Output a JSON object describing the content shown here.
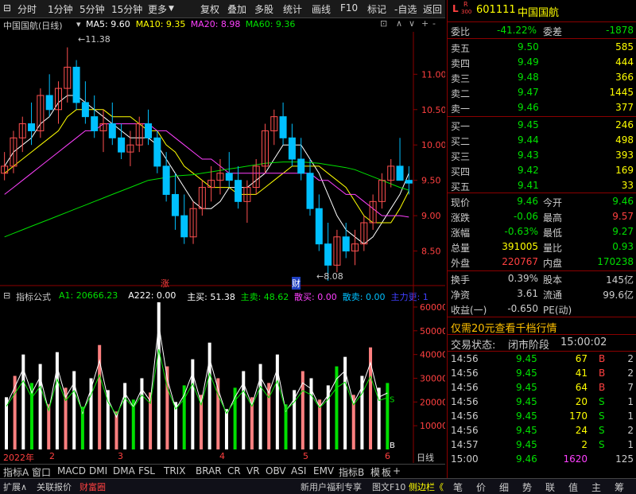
{
  "toolbar": {
    "left": [
      "分时",
      "1分钟",
      "5分钟",
      "15分钟",
      "更多"
    ],
    "right": [
      "复权",
      "叠加",
      "多股",
      "统计",
      "画线",
      "F10",
      "标记",
      "-自选",
      "返回"
    ]
  },
  "chart": {
    "name": "中国国航(日线)",
    "ma": [
      {
        "label": "MA5: 9.60",
        "color": "#ffffff"
      },
      {
        "label": "MA10: 9.35",
        "color": "#ffff00"
      },
      {
        "label": "MA20: 8.98",
        "color": "#ff40ff"
      },
      {
        "label": "MA60: 9.36",
        "color": "#00e000"
      }
    ],
    "high_label": "11.38",
    "low_label": "8.08",
    "marker_zhang": "涨",
    "marker_cai": "财",
    "price_axis": [
      "11.00",
      "10.50",
      "10.00",
      "9.50",
      "9.00",
      "8.50"
    ],
    "colors": {
      "up": "#ff5050",
      "down": "#00c0ff",
      "grid": "#8b0000"
    }
  },
  "chart_data": {
    "type": "line",
    "title": "中国国航(日线)",
    "x": [
      "2022年",
      "2",
      "3",
      "4",
      "5",
      "6"
    ],
    "price_ylim": [
      8.0,
      11.6
    ],
    "candles": [
      [
        9.6,
        9.9,
        9.5,
        9.7
      ],
      [
        9.7,
        10.2,
        9.6,
        10.1
      ],
      [
        10.1,
        10.4,
        9.9,
        10.3
      ],
      [
        10.3,
        10.6,
        10.0,
        10.2
      ],
      [
        10.2,
        10.8,
        10.1,
        10.7
      ],
      [
        10.7,
        11.0,
        10.4,
        10.5
      ],
      [
        10.5,
        10.9,
        10.3,
        10.8
      ],
      [
        10.8,
        11.38,
        10.6,
        11.1
      ],
      [
        11.1,
        11.2,
        10.5,
        10.6
      ],
      [
        10.6,
        10.9,
        10.3,
        10.4
      ],
      [
        10.4,
        10.7,
        10.1,
        10.2
      ],
      [
        10.2,
        10.5,
        9.9,
        10.3
      ],
      [
        10.3,
        10.6,
        10.0,
        10.1
      ],
      [
        10.1,
        10.3,
        9.8,
        9.9
      ],
      [
        9.9,
        10.2,
        9.7,
        10.0
      ],
      [
        10.0,
        10.4,
        9.9,
        10.3
      ],
      [
        10.3,
        10.5,
        10.0,
        10.1
      ],
      [
        10.1,
        10.2,
        9.6,
        9.7
      ],
      [
        9.7,
        9.9,
        9.2,
        9.3
      ],
      [
        9.3,
        9.6,
        8.8,
        9.0
      ],
      [
        9.0,
        9.3,
        8.6,
        8.7
      ],
      [
        8.7,
        9.2,
        8.6,
        9.1
      ],
      [
        9.1,
        9.5,
        9.0,
        9.4
      ],
      [
        9.4,
        9.7,
        9.2,
        9.5
      ],
      [
        9.5,
        9.8,
        9.3,
        9.6
      ],
      [
        9.6,
        9.9,
        9.4,
        9.5
      ],
      [
        9.5,
        9.7,
        9.1,
        9.2
      ],
      [
        9.2,
        9.5,
        8.9,
        9.4
      ],
      [
        9.4,
        9.8,
        9.3,
        9.7
      ],
      [
        9.7,
        10.3,
        9.6,
        10.2
      ],
      [
        10.2,
        10.5,
        10.0,
        10.4
      ],
      [
        10.4,
        10.6,
        10.0,
        10.1
      ],
      [
        10.1,
        10.3,
        9.7,
        9.8
      ],
      [
        9.8,
        10.1,
        9.5,
        9.6
      ],
      [
        9.6,
        9.8,
        9.0,
        9.1
      ],
      [
        9.1,
        9.3,
        8.5,
        8.6
      ],
      [
        8.6,
        8.9,
        8.08,
        8.3
      ],
      [
        8.3,
        8.8,
        8.2,
        8.7
      ],
      [
        8.7,
        8.9,
        8.4,
        8.5
      ],
      [
        8.5,
        8.8,
        8.3,
        8.6
      ],
      [
        8.6,
        9.0,
        8.5,
        8.9
      ],
      [
        8.9,
        9.3,
        8.8,
        9.2
      ],
      [
        9.2,
        9.6,
        9.1,
        9.5
      ],
      [
        9.5,
        9.8,
        9.4,
        9.7
      ],
      [
        9.7,
        10.1,
        9.6,
        9.5
      ],
      [
        9.5,
        9.7,
        9.3,
        9.46
      ]
    ],
    "series": [
      {
        "name": "MA5",
        "values": [
          9.7,
          9.9,
          10.0,
          10.1,
          10.3,
          10.4,
          10.6,
          10.7,
          10.7,
          10.6,
          10.5,
          10.4,
          10.3,
          10.2,
          10.1,
          10.1,
          10.1,
          10.0,
          9.8,
          9.6,
          9.4,
          9.2,
          9.1,
          9.1,
          9.2,
          9.4,
          9.4,
          9.4,
          9.5,
          9.6,
          9.8,
          10.0,
          10.0,
          10.0,
          9.8,
          9.6,
          9.3,
          9.0,
          8.8,
          8.7,
          8.6,
          8.7,
          8.9,
          9.1,
          9.3,
          9.6
        ]
      },
      {
        "name": "MA10",
        "values": [
          9.6,
          9.7,
          9.8,
          9.9,
          10.0,
          10.1,
          10.2,
          10.4,
          10.5,
          10.5,
          10.5,
          10.5,
          10.4,
          10.4,
          10.4,
          10.3,
          10.2,
          10.2,
          10.0,
          9.9,
          9.7,
          9.6,
          9.5,
          9.4,
          9.4,
          9.4,
          9.3,
          9.3,
          9.3,
          9.4,
          9.5,
          9.6,
          9.7,
          9.7,
          9.7,
          9.7,
          9.6,
          9.5,
          9.4,
          9.2,
          9.0,
          8.9,
          8.9,
          8.9,
          9.1,
          9.35
        ]
      },
      {
        "name": "MA20",
        "values": [
          9.3,
          9.4,
          9.5,
          9.6,
          9.7,
          9.8,
          9.9,
          10.0,
          10.1,
          10.2,
          10.2,
          10.3,
          10.3,
          10.3,
          10.3,
          10.3,
          10.3,
          10.2,
          10.2,
          10.1,
          10.0,
          9.9,
          9.8,
          9.8,
          9.7,
          9.6,
          9.6,
          9.6,
          9.6,
          9.6,
          9.6,
          9.6,
          9.6,
          9.6,
          9.6,
          9.5,
          9.5,
          9.4,
          9.3,
          9.3,
          9.2,
          9.1,
          9.0,
          9.0,
          9.0,
          8.98
        ]
      },
      {
        "name": "MA60",
        "values": [
          8.7,
          8.75,
          8.8,
          8.85,
          8.9,
          8.95,
          9.0,
          9.05,
          9.1,
          9.15,
          9.2,
          9.25,
          9.3,
          9.35,
          9.4,
          9.45,
          9.5,
          9.52,
          9.54,
          9.56,
          9.57,
          9.58,
          9.6,
          9.62,
          9.64,
          9.66,
          9.68,
          9.7,
          9.72,
          9.74,
          9.75,
          9.76,
          9.76,
          9.76,
          9.75,
          9.74,
          9.72,
          9.7,
          9.68,
          9.65,
          9.6,
          9.55,
          9.5,
          9.45,
          9.4,
          9.36
        ]
      }
    ]
  },
  "indicator": {
    "name": "指标公式",
    "fields": [
      {
        "text": "A1: 20666.23",
        "color": "#00e000"
      },
      {
        "text": "A222: 0.00",
        "color": "#ffffff"
      },
      {
        "text": "主买: 51.38",
        "color": "#ffffff"
      },
      {
        "text": "主卖: 48.62",
        "color": "#00e000"
      },
      {
        "text": "散买: 0.00",
        "color": "#ff40ff"
      },
      {
        "text": "散卖: 0.00",
        "color": "#00c0ff"
      },
      {
        "text": "主力更: 1",
        "color": "#4040ff"
      }
    ],
    "axis": [
      "60000",
      "50000",
      "40000",
      "30000",
      "20000",
      "10000"
    ],
    "b_label": "B",
    "s_label": "S",
    "values": [
      22000,
      31000,
      40000,
      28000,
      36000,
      19000,
      41000,
      26000,
      33000,
      18000,
      30000,
      44000,
      25000,
      16000,
      28000,
      21000,
      30000,
      24000,
      62000,
      35000,
      20000,
      27000,
      38000,
      23000,
      45000,
      30000,
      17000,
      26000,
      33000,
      22000,
      36000,
      28000,
      40000,
      19000,
      25000,
      33000,
      30000,
      21000,
      27000,
      35000,
      39000,
      23000,
      31000,
      43000,
      26000,
      28000
    ]
  },
  "time_axis": {
    "labels": [
      "2022年",
      "2",
      "3",
      "4",
      "5",
      "6"
    ],
    "period": "日线"
  },
  "bottom_tabs": [
    "指标A",
    "窗口",
    "MACD",
    "DMI",
    "DMA",
    "FSL",
    "TRIX",
    "BRAR",
    "CR",
    "VR",
    "OBV",
    "ASI",
    "EMV",
    "指标B",
    "模",
    "板",
    "+"
  ],
  "footer": {
    "left": [
      "扩展∧",
      "关联报价",
      "财富圈"
    ],
    "middle": "新用户福利专享",
    "right_links": [
      "图文F10",
      "侧边栏《"
    ],
    "right_tabs": [
      "笔",
      "价",
      "细",
      "势",
      "联",
      "值",
      "主",
      "筹"
    ]
  },
  "quote": {
    "code": "601111",
    "name": "中国国航",
    "badge_top": "R",
    "badge_num": "300",
    "wei_bi_label": "委比",
    "wei_bi": "-41.22%",
    "wei_cha_label": "委差",
    "wei_cha": "-1878",
    "asks": [
      {
        "label": "卖五",
        "price": "9.50",
        "vol": "585"
      },
      {
        "label": "卖四",
        "price": "9.49",
        "vol": "444"
      },
      {
        "label": "卖三",
        "price": "9.48",
        "vol": "366"
      },
      {
        "label": "卖二",
        "price": "9.47",
        "vol": "1445"
      },
      {
        "label": "卖一",
        "price": "9.46",
        "vol": "377"
      }
    ],
    "bids": [
      {
        "label": "买一",
        "price": "9.45",
        "vol": "246"
      },
      {
        "label": "买二",
        "price": "9.44",
        "vol": "498"
      },
      {
        "label": "买三",
        "price": "9.43",
        "vol": "393"
      },
      {
        "label": "买四",
        "price": "9.42",
        "vol": "169"
      },
      {
        "label": "买五",
        "price": "9.41",
        "vol": "33"
      }
    ],
    "stats": [
      {
        "l1": "现价",
        "v1": "9.46",
        "c1": "green",
        "l2": "今开",
        "v2": "9.46",
        "c2": "green"
      },
      {
        "l1": "涨跌",
        "v1": "-0.06",
        "c1": "green",
        "l2": "最高",
        "v2": "9.57",
        "c2": "red"
      },
      {
        "l1": "涨幅",
        "v1": "-0.63%",
        "c1": "green",
        "l2": "最低",
        "v2": "9.27",
        "c2": "green"
      },
      {
        "l1": "总量",
        "v1": "391005",
        "c1": "yellow",
        "l2": "量比",
        "v2": "0.93",
        "c2": "green"
      },
      {
        "l1": "外盘",
        "v1": "220767",
        "c1": "red",
        "l2": "内盘",
        "v2": "170238",
        "c2": "green"
      }
    ],
    "stats2": [
      {
        "l1": "换手",
        "v1": "0.39%",
        "l2": "股本",
        "v2": "145亿"
      },
      {
        "l1": "净资",
        "v1": "3.61",
        "l2": "流通",
        "v2": "99.6亿"
      },
      {
        "l1": "收益(一)",
        "v1": "-0.650",
        "l2": "PE(动)",
        "v2": ""
      }
    ],
    "promo": "仅需20元查看千档行情",
    "trade_state_label": "交易状态:",
    "trade_state": "闭市阶段",
    "trade_time": "15:00:02",
    "ticks": [
      {
        "t": "14:56",
        "p": "9.45",
        "v": "67",
        "bs": "B",
        "n": "2"
      },
      {
        "t": "14:56",
        "p": "9.45",
        "v": "41",
        "bs": "B",
        "n": "2"
      },
      {
        "t": "14:56",
        "p": "9.45",
        "v": "64",
        "bs": "B",
        "n": "7"
      },
      {
        "t": "14:56",
        "p": "9.45",
        "v": "20",
        "bs": "S",
        "n": "1"
      },
      {
        "t": "14:56",
        "p": "9.45",
        "v": "170",
        "bs": "S",
        "n": "1"
      },
      {
        "t": "14:56",
        "p": "9.45",
        "v": "24",
        "bs": "S",
        "n": "2"
      },
      {
        "t": "14:57",
        "p": "9.45",
        "v": "2",
        "bs": "S",
        "n": "1"
      },
      {
        "t": "15:00",
        "p": "9.46",
        "v": "1620",
        "bs": "",
        "n": "125"
      }
    ]
  }
}
